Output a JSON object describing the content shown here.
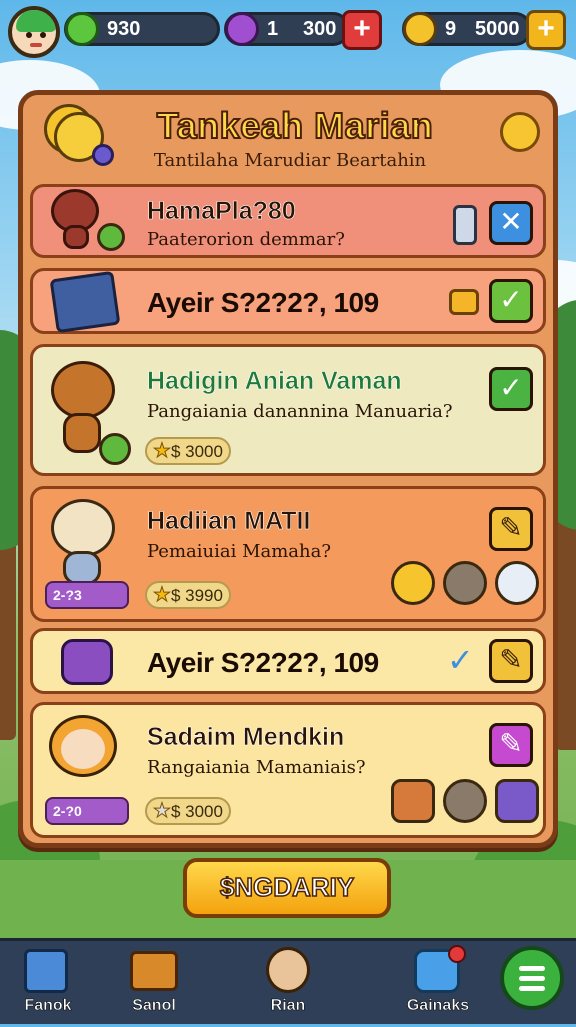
{
  "topbar": {
    "resource1": {
      "value": "930",
      "icon": "green-gem-icon"
    },
    "resource2": {
      "value1": "1",
      "value2": "300",
      "icon": "purple-gem-icon",
      "add_label": "+"
    },
    "resource3": {
      "value1": "9",
      "value2": "5000",
      "icon": "gold-coin-icon",
      "add_label": "+"
    }
  },
  "panel": {
    "title": "Tankeah Marian",
    "subtitle": "Tantilaha Marudiar Beartahin"
  },
  "rows": [
    {
      "name": "HamaPla?80",
      "desc": "Paaterorion demmar?",
      "action": "✕"
    },
    {
      "wide": "Ayeir S?2?2?, 109",
      "action": "✓"
    },
    {
      "name": "Hadigin Anian Vaman",
      "desc": "Pangaiania danannina Manuaria?",
      "price": "$ 3000",
      "action": "✓"
    },
    {
      "name": "Hadiian MATII",
      "desc": "Pemaiuiai Mamaha?",
      "tag": "2-?3",
      "price": "$ 3990",
      "action": "✎"
    },
    {
      "wide": "Ayeir S?2?2?, 109",
      "action": "✎"
    },
    {
      "name": "Sadaim Mendkin",
      "desc": "Rangaiania Mamaniais?",
      "tag": "2-?0",
      "price": "$ 3000",
      "action": "✎"
    }
  ],
  "cta": {
    "label": "$NGDARIY"
  },
  "nav": [
    {
      "label": "Fanok",
      "icon": "crate-icon"
    },
    {
      "label": "Sanol",
      "icon": "book-stack-icon"
    },
    {
      "label": "Rian",
      "icon": "pet-icon"
    },
    {
      "label": "Gainaks",
      "icon": "puzzle-icon"
    }
  ],
  "colors": {
    "panel": "#e89a5e",
    "panel_border": "#7a3b17",
    "title": "#ffd84a",
    "accent_green": "#3bb13e"
  }
}
